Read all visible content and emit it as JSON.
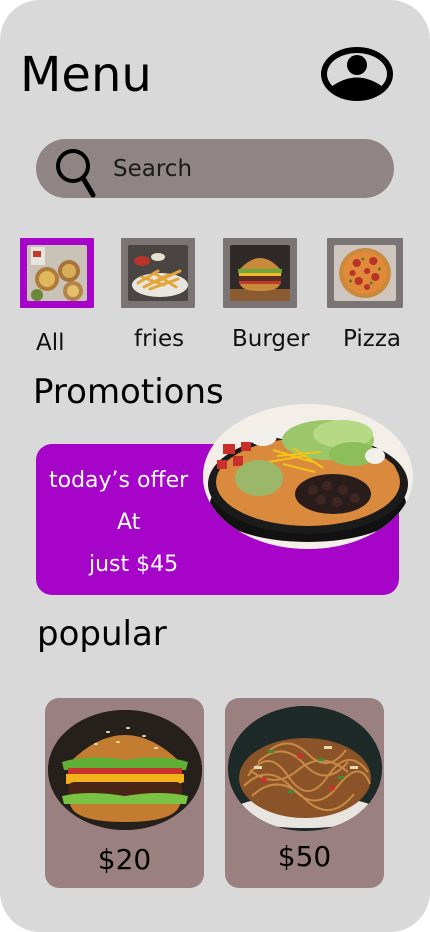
{
  "header": {
    "title": "Menu"
  },
  "search": {
    "placeholder": "Search"
  },
  "categories": [
    {
      "label": "All",
      "selected": true
    },
    {
      "label": "fries",
      "selected": false
    },
    {
      "label": "Burger",
      "selected": false
    },
    {
      "label": "Pizza",
      "selected": false
    }
  ],
  "promotions": {
    "heading": "Promotions",
    "offer_line1": "today’s offer",
    "offer_line2": "At",
    "offer_line3": "just $45"
  },
  "popular": {
    "heading": "popular",
    "items": [
      {
        "name": "burger",
        "price": "$20"
      },
      {
        "name": "noodles",
        "price": "$50"
      }
    ]
  },
  "colors": {
    "background": "#d9d9d9",
    "search_bar": "#8f8585",
    "accent_purple": "#a704c9",
    "card": "#9a8080",
    "category_frame": "#7a7474"
  },
  "icons": [
    "profile-icon",
    "search-icon"
  ]
}
